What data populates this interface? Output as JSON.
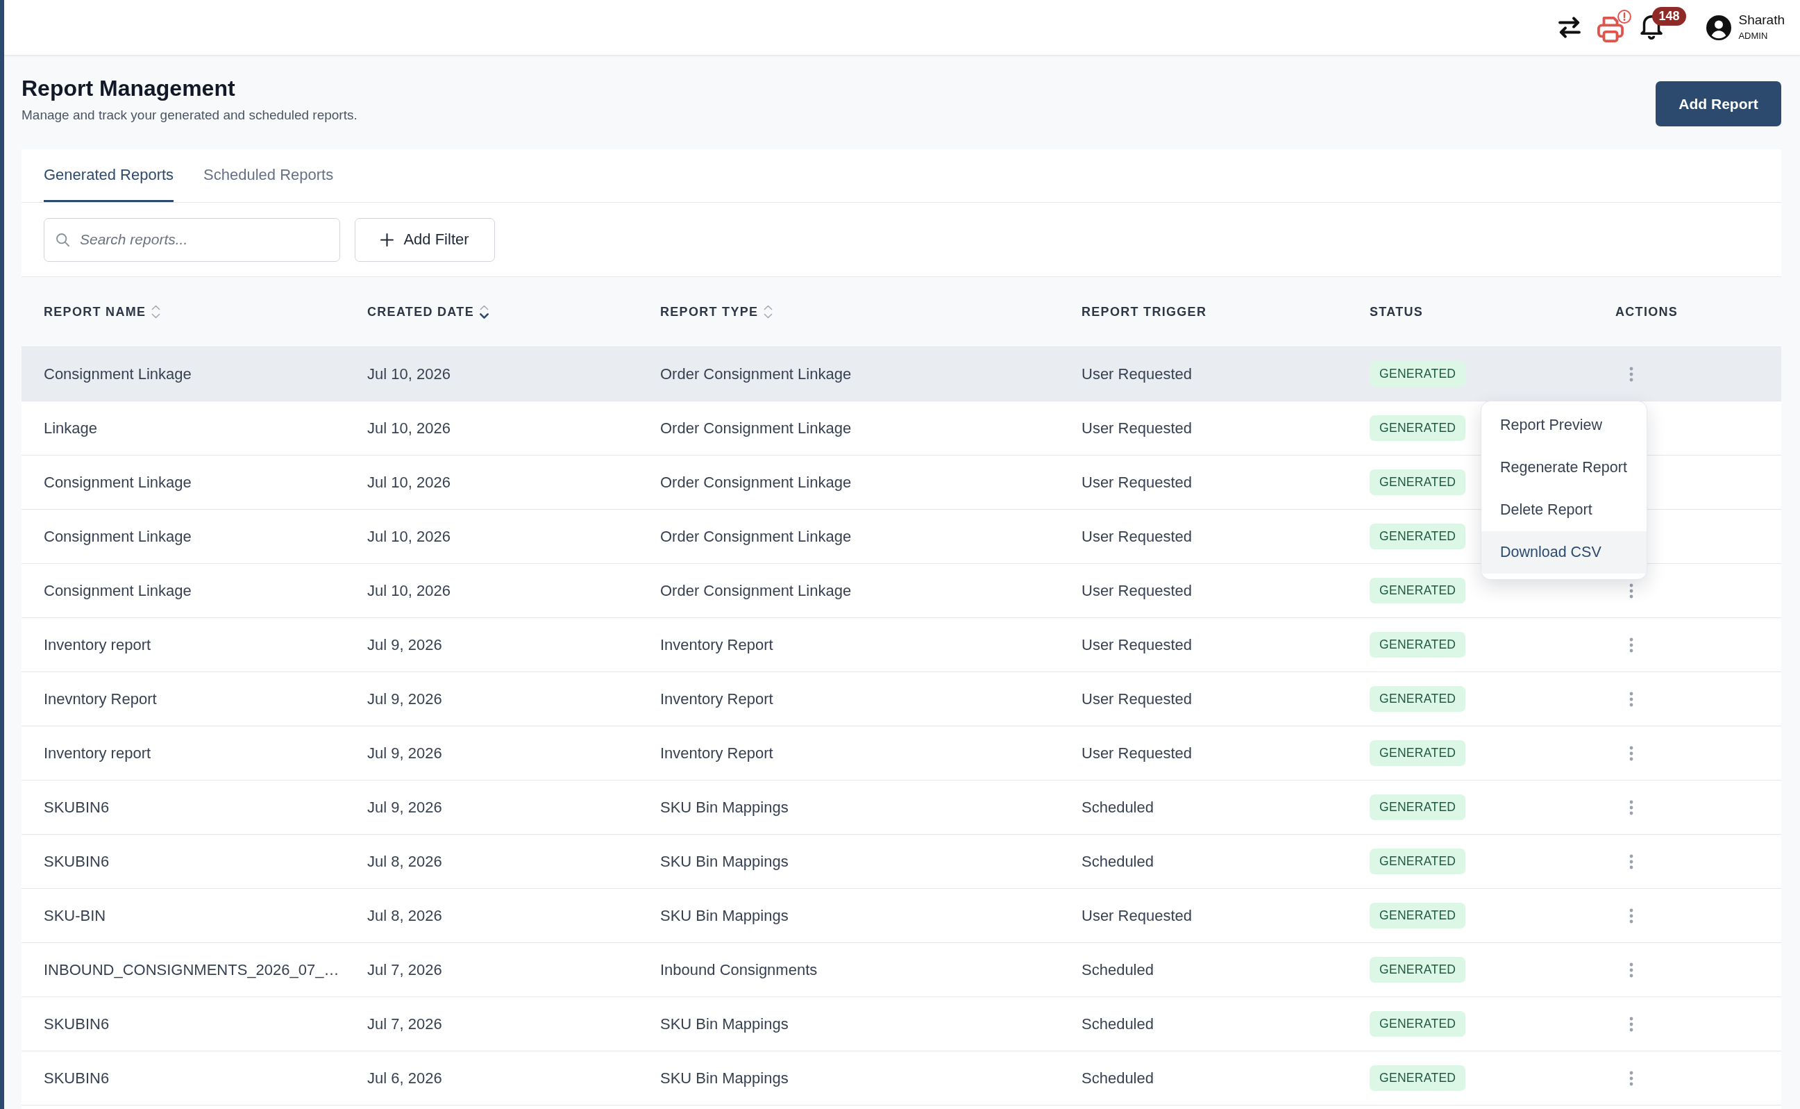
{
  "top_bar": {
    "printer_alert": true,
    "notification_count": "148",
    "user_name": "Sharath",
    "user_role": "ADMIN"
  },
  "page": {
    "title": "Report Management",
    "subtitle": "Manage and track your generated and scheduled reports.",
    "primary_button": "Add Report"
  },
  "tabs": [
    {
      "label": "Generated Reports",
      "selected": true
    },
    {
      "label": "Scheduled Reports",
      "selected": false
    }
  ],
  "search": {
    "placeholder": "Search reports..."
  },
  "filter_button": "Add Filter",
  "table": {
    "columns": [
      {
        "label": "REPORT NAME",
        "sorted": false
      },
      {
        "label": "CREATED DATE",
        "sorted": true
      },
      {
        "label": "REPORT TYPE",
        "sorted": false
      },
      {
        "label": "REPORT TRIGGER"
      },
      {
        "label": "STATUS"
      },
      {
        "label": "ACTIONS"
      }
    ],
    "rows": [
      {
        "cells": [
          "Consignment Linkage",
          "Jul 10, 2026",
          "Order Consignment Linkage",
          "User Requested"
        ],
        "status": "GENERATED",
        "highlighted": true
      },
      {
        "cells": [
          "Linkage",
          "Jul 10, 2026",
          "Order Consignment Linkage",
          "User Requested"
        ],
        "status": "GENERATED",
        "highlighted": false
      },
      {
        "cells": [
          "Consignment Linkage",
          "Jul 10, 2026",
          "Order Consignment Linkage",
          "User Requested"
        ],
        "status": "GENERATED",
        "highlighted": false
      },
      {
        "cells": [
          "Consignment Linkage",
          "Jul 10, 2026",
          "Order Consignment Linkage",
          "User Requested"
        ],
        "status": "GENERATED",
        "highlighted": false
      },
      {
        "cells": [
          "Consignment Linkage",
          "Jul 10, 2026",
          "Order Consignment Linkage",
          "User Requested"
        ],
        "status": "GENERATED",
        "highlighted": false
      },
      {
        "cells": [
          "Inventory report",
          "Jul 9, 2026",
          "Inventory Report",
          "User Requested"
        ],
        "status": "GENERATED",
        "highlighted": false
      },
      {
        "cells": [
          "Inevntory Report",
          "Jul 9, 2026",
          "Inventory Report",
          "User Requested"
        ],
        "status": "GENERATED",
        "highlighted": false
      },
      {
        "cells": [
          "Inventory report",
          "Jul 9, 2026",
          "Inventory Report",
          "User Requested"
        ],
        "status": "GENERATED",
        "highlighted": false
      },
      {
        "cells": [
          "SKUBIN6",
          "Jul 9, 2026",
          "SKU Bin Mappings",
          "Scheduled"
        ],
        "status": "GENERATED",
        "highlighted": false
      },
      {
        "cells": [
          "SKUBIN6",
          "Jul 8, 2026",
          "SKU Bin Mappings",
          "Scheduled"
        ],
        "status": "GENERATED",
        "highlighted": false
      },
      {
        "cells": [
          "SKU-BIN",
          "Jul 8, 2026",
          "SKU Bin Mappings",
          "User Requested"
        ],
        "status": "GENERATED",
        "highlighted": false
      },
      {
        "cells": [
          "INBOUND_CONSIGNMENTS_2026_07_…",
          "Jul 7, 2026",
          "Inbound Consignments",
          "Scheduled"
        ],
        "status": "GENERATED",
        "highlighted": false
      },
      {
        "cells": [
          "SKUBIN6",
          "Jul 7, 2026",
          "SKU Bin Mappings",
          "Scheduled"
        ],
        "status": "GENERATED",
        "highlighted": false
      },
      {
        "cells": [
          "SKUBIN6",
          "Jul 6, 2026",
          "SKU Bin Mappings",
          "Scheduled"
        ],
        "status": "GENERATED",
        "highlighted": false
      }
    ]
  },
  "action_menu": {
    "open": true,
    "items": [
      {
        "label": "Report Preview",
        "highlighted": false
      },
      {
        "label": "Regenerate Report",
        "highlighted": false
      },
      {
        "label": "Delete Report",
        "highlighted": false
      },
      {
        "label": "Download CSV",
        "highlighted": true
      }
    ]
  }
}
